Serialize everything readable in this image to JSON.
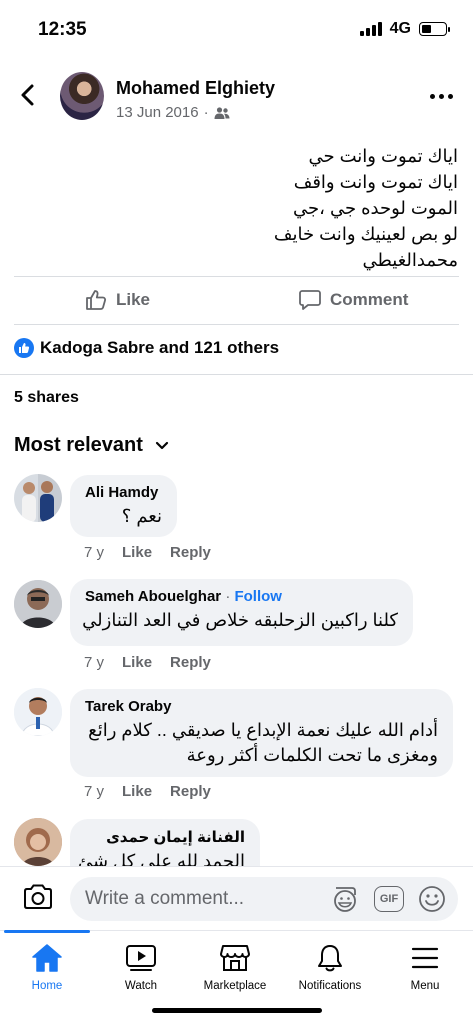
{
  "status_bar": {
    "time": "12:35",
    "network": "4G"
  },
  "post": {
    "author": "Mohamed Elghiety",
    "date": "13 Jun 2016",
    "separator": "·",
    "text_lines": [
      "اياك تموت وانت حي",
      "اياك تموت وانت واقف",
      "الموت لوحده جي ،جي",
      "لو بص لعينيك وانت خايف",
      "محمدالغيطي"
    ]
  },
  "actions": {
    "like_label": "Like",
    "comment_label": "Comment"
  },
  "reactions": {
    "summary": "Kadoga Sabre and 121 others"
  },
  "shares": {
    "label": "5 shares"
  },
  "sort": {
    "label": "Most relevant"
  },
  "comments": [
    {
      "name": "Ali Hamdy",
      "text": "نعم ؟",
      "age": "7 y",
      "like": "Like",
      "reply": "Reply"
    },
    {
      "name": "Sameh Abouelghar",
      "dot": "·",
      "follow": "Follow",
      "text": "كلنا راكبين الزحلبقه خلاص في العد التنازلي",
      "age": "7 y",
      "like": "Like",
      "reply": "Reply"
    },
    {
      "name": "Tarek Oraby",
      "text_lines": [
        "أدام الله عليك نعمة الإبداع يا صديقي .. كلام رائع",
        "ومغزى ما تحت الكلمات أكثر روعة"
      ],
      "age": "7 y",
      "like": "Like",
      "reply": "Reply"
    },
    {
      "name": "الفنانة إيمان حمدى",
      "text": "الحمد لله على كل شئ"
    }
  ],
  "composer": {
    "placeholder": "Write a comment...",
    "gif_label": "GIF"
  },
  "tabs": [
    {
      "label": "Home",
      "icon": "home-icon",
      "active": true
    },
    {
      "label": "Watch",
      "icon": "watch-icon"
    },
    {
      "label": "Marketplace",
      "icon": "marketplace-icon"
    },
    {
      "label": "Notifications",
      "icon": "bell-icon"
    },
    {
      "label": "Menu",
      "icon": "menu-icon"
    }
  ],
  "colors": {
    "accent": "#1877f2",
    "secondary_text": "#65676b",
    "bubble": "#f0f2f5"
  }
}
